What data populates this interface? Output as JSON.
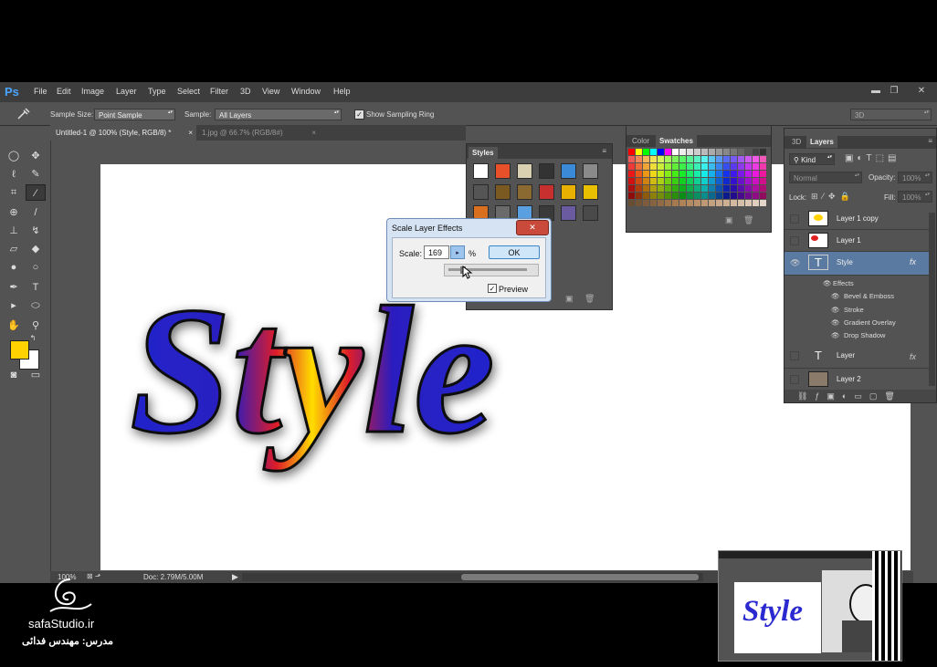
{
  "app": {
    "logo": "Ps"
  },
  "menu": [
    "File",
    "Edit",
    "Image",
    "Layer",
    "Type",
    "Select",
    "Filter",
    "3D",
    "View",
    "Window",
    "Help"
  ],
  "window_controls": {
    "minimize": "▬",
    "restore": "❐",
    "close": "✕"
  },
  "options_bar": {
    "sample_size_label": "Sample Size:",
    "sample_size_value": "Point Sample",
    "sample_label": "Sample:",
    "sample_value": "All Layers",
    "show_ring_label": "Show Sampling Ring",
    "workspace": "3D"
  },
  "doc_tabs": [
    {
      "label": "Untitled-1 @ 100% (Style, RGB/8) *",
      "close": "×",
      "active": true
    },
    {
      "label": "1.jpg @ 66.7% (RGB/8#)",
      "close": "×",
      "active": false
    }
  ],
  "canvas": {
    "artwork_text": "Style"
  },
  "status": {
    "zoom": "100%",
    "doc": "Doc: 2.79M/5.00M"
  },
  "styles_panel": {
    "tab": "Styles"
  },
  "color_panel": {
    "tabs": [
      "Color",
      "Swatches"
    ]
  },
  "dialog": {
    "title": "Scale Layer Effects",
    "scale_label": "Scale:",
    "scale_value": "169",
    "unit": "%",
    "ok_label": "OK",
    "preview_label": "Preview",
    "preview_checked": true,
    "close": "✕"
  },
  "layers_panel": {
    "tabs": [
      "3D",
      "Layers"
    ],
    "filter_label": "Kind",
    "blend_mode": "Normal",
    "opacity_label": "Opacity:",
    "opacity_value": "100%",
    "lock_label": "Lock:",
    "fill_label": "Fill:",
    "fill_value": "100%",
    "layers": [
      {
        "name": "Layer 1 copy",
        "visible": false
      },
      {
        "name": "Layer 1",
        "visible": false
      },
      {
        "name": "Style",
        "visible": true,
        "selected": true,
        "fx": "fx"
      },
      {
        "name": "Layer",
        "visible": false,
        "fx": "fx"
      },
      {
        "name": "Layer 2",
        "visible": false
      }
    ],
    "effects_header": "Effects",
    "effects": [
      "Bevel & Emboss",
      "Stroke",
      "Gradient Overlay",
      "Drop Shadow"
    ]
  },
  "watermark": {
    "site": "safaStudio.ir",
    "teacher": "مدرس: مهندس فدائی"
  },
  "colors": {
    "accent": "#4aa4ff",
    "foreground": "#ffd200",
    "background": "#ffffff",
    "selection": "#5b7aa1"
  }
}
